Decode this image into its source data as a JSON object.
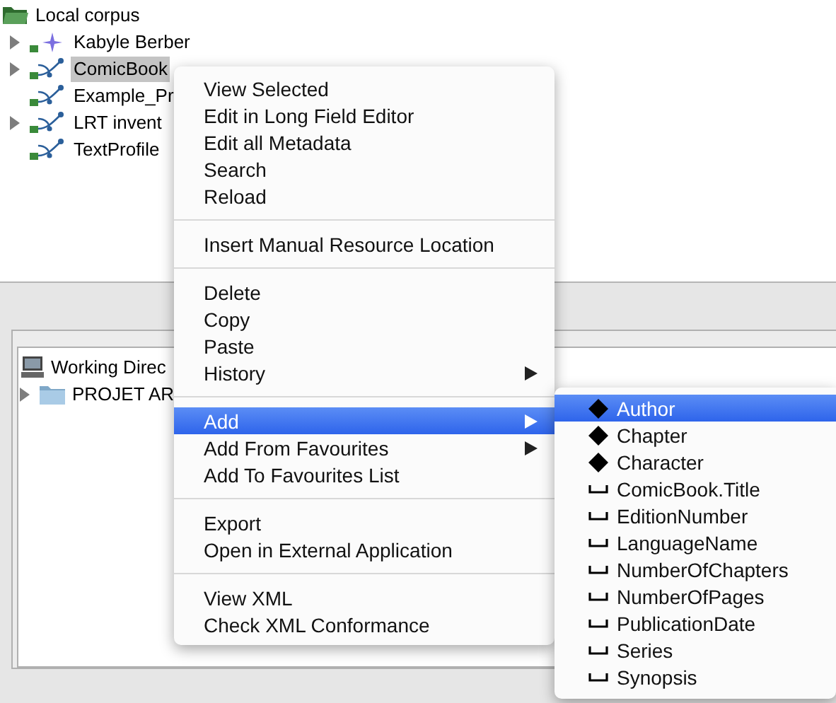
{
  "corpus_tree": {
    "root": {
      "label": "Local corpus",
      "children": [
        {
          "label": "Kabyle Berber",
          "kind": "star",
          "expandable": true,
          "selected": false
        },
        {
          "label": "ComicBook",
          "kind": "profile",
          "expandable": true,
          "selected": true
        },
        {
          "label": "Example_Pr",
          "kind": "profile",
          "expandable": false,
          "selected": false
        },
        {
          "label": "LRT invent",
          "kind": "profile",
          "expandable": true,
          "selected": false
        },
        {
          "label": "TextProfile",
          "kind": "profile",
          "expandable": false,
          "selected": false
        }
      ]
    }
  },
  "files_tree": {
    "root": {
      "label": "Working Direc",
      "children": [
        {
          "label": "PROJET AR",
          "kind": "folder",
          "expandable": true,
          "selected": false
        }
      ]
    }
  },
  "context_menu": {
    "sections": [
      {
        "items": [
          {
            "label": "View Selected",
            "has_submenu": false,
            "selected": false
          },
          {
            "label": "Edit in Long Field Editor",
            "has_submenu": false,
            "selected": false
          },
          {
            "label": "Edit all Metadata",
            "has_submenu": false,
            "selected": false
          },
          {
            "label": "Search",
            "has_submenu": false,
            "selected": false
          },
          {
            "label": "Reload",
            "has_submenu": false,
            "selected": false
          }
        ]
      },
      {
        "items": [
          {
            "label": "Insert Manual Resource Location",
            "has_submenu": false,
            "selected": false
          }
        ]
      },
      {
        "items": [
          {
            "label": "Delete",
            "has_submenu": false,
            "selected": false
          },
          {
            "label": "Copy",
            "has_submenu": false,
            "selected": false
          },
          {
            "label": "Paste",
            "has_submenu": false,
            "selected": false
          },
          {
            "label": "History",
            "has_submenu": true,
            "selected": false
          }
        ]
      },
      {
        "items": [
          {
            "label": "Add",
            "has_submenu": true,
            "selected": true
          },
          {
            "label": "Add From Favourites",
            "has_submenu": true,
            "selected": false
          },
          {
            "label": "Add To Favourites List",
            "has_submenu": false,
            "selected": false
          }
        ]
      },
      {
        "items": [
          {
            "label": "Export",
            "has_submenu": false,
            "selected": false
          },
          {
            "label": "Open in External Application",
            "has_submenu": false,
            "selected": false
          }
        ]
      },
      {
        "items": [
          {
            "label": "View XML",
            "has_submenu": false,
            "selected": false
          },
          {
            "label": "Check XML Conformance",
            "has_submenu": false,
            "selected": false
          }
        ]
      }
    ]
  },
  "add_submenu": {
    "items": [
      {
        "label": "Author",
        "kind": "element",
        "selected": true
      },
      {
        "label": "Chapter",
        "kind": "element",
        "selected": false
      },
      {
        "label": "Character",
        "kind": "element",
        "selected": false
      },
      {
        "label": "ComicBook.Title",
        "kind": "field",
        "selected": false
      },
      {
        "label": "EditionNumber",
        "kind": "field",
        "selected": false
      },
      {
        "label": "LanguageName",
        "kind": "field",
        "selected": false
      },
      {
        "label": "NumberOfChapters",
        "kind": "field",
        "selected": false
      },
      {
        "label": "NumberOfPages",
        "kind": "field",
        "selected": false
      },
      {
        "label": "PublicationDate",
        "kind": "field",
        "selected": false
      },
      {
        "label": "Series",
        "kind": "field",
        "selected": false
      },
      {
        "label": "Synopsis",
        "kind": "field",
        "selected": false
      }
    ]
  }
}
